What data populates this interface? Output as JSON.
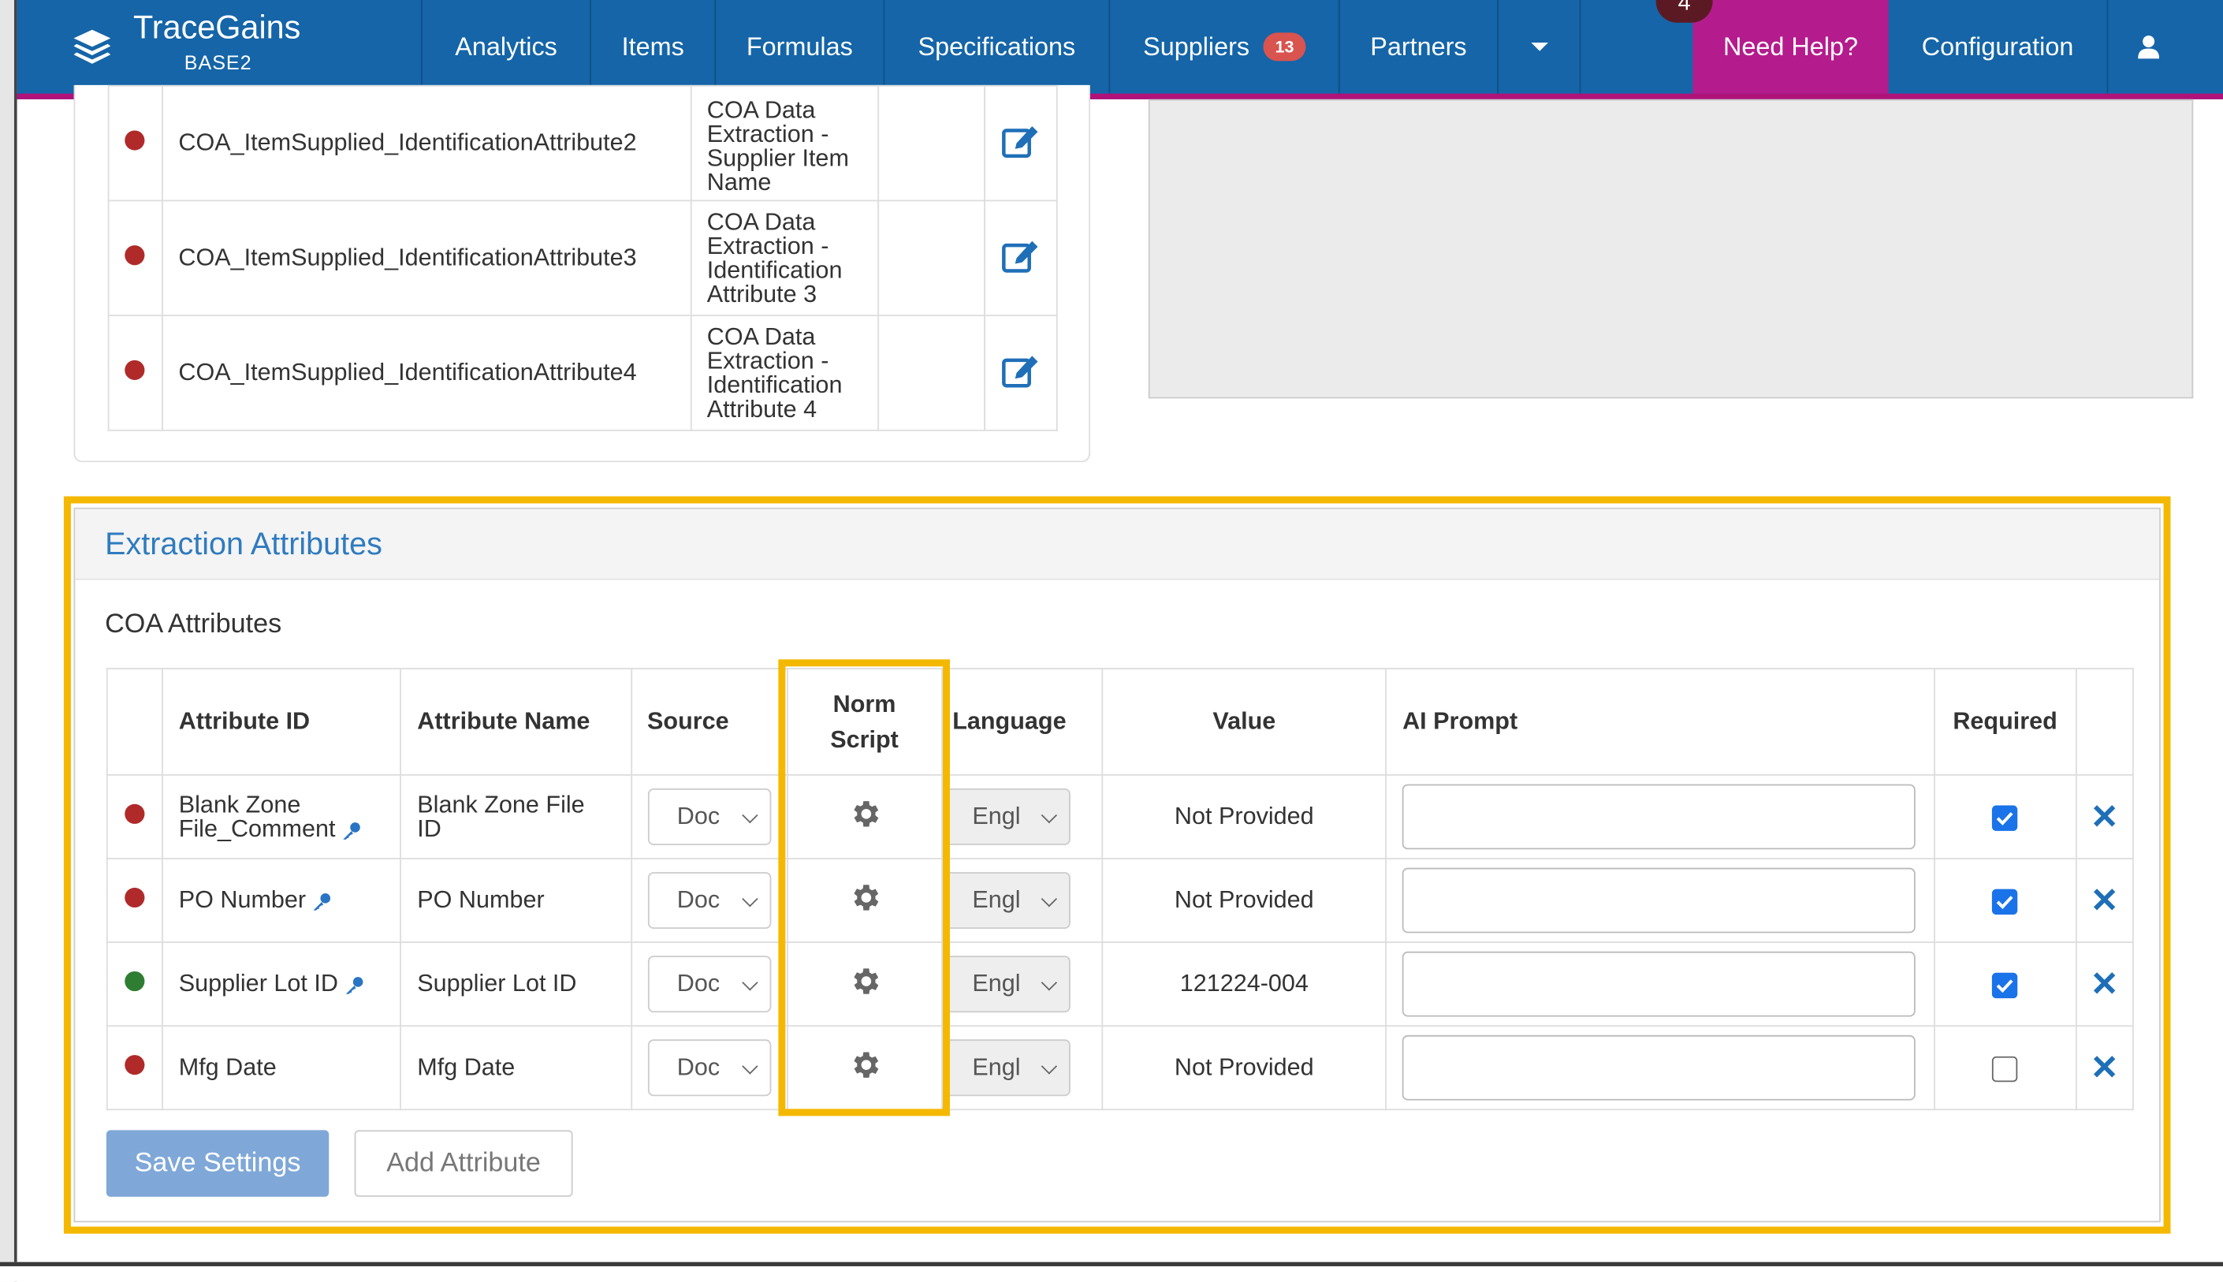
{
  "nav": {
    "brand": "TraceGains",
    "instance": "BASE2",
    "items": [
      "Analytics",
      "Items",
      "Formulas",
      "Specifications",
      "Suppliers",
      "Partners"
    ],
    "suppliers_badge": "13",
    "help_badge": "4",
    "help": "Need Help?",
    "configuration": "Configuration"
  },
  "upper_rows": [
    {
      "id": "COA_ItemSupplied_IdentificationAttribute2",
      "desc": "COA Data Extraction - Supplier Item Name",
      "status": "red"
    },
    {
      "id": "COA_ItemSupplied_IdentificationAttribute3",
      "desc": "COA Data Extraction - Identification Attribute 3",
      "status": "red"
    },
    {
      "id": "COA_ItemSupplied_IdentificationAttribute4",
      "desc": "COA Data Extraction - Identification Attribute 4",
      "status": "red"
    }
  ],
  "section": {
    "title": "Extraction Attributes",
    "subtitle": "COA Attributes",
    "headers": {
      "attribute_id": "Attribute ID",
      "attribute_name": "Attribute Name",
      "source": "Source",
      "norm_script": "Norm Script",
      "language": "Language",
      "value": "Value",
      "ai_prompt": "AI Prompt",
      "required": "Required"
    },
    "rows": [
      {
        "attr_id": "Blank Zone File_Comment",
        "name": "Blank Zone File ID",
        "source": "Doc",
        "language": "Engl",
        "value": "Not Provided",
        "required": true,
        "status": "red"
      },
      {
        "attr_id": "PO Number",
        "name": "PO Number",
        "source": "Doc",
        "language": "Engl",
        "value": "Not Provided",
        "required": true,
        "status": "red"
      },
      {
        "attr_id": "Supplier Lot ID",
        "name": "Supplier Lot ID",
        "source": "Doc",
        "language": "Engl",
        "value": "121224-004",
        "required": true,
        "status": "green"
      },
      {
        "attr_id": "Mfg Date",
        "name": "Mfg Date",
        "source": "Doc",
        "language": "Engl",
        "value": "Not Provided",
        "required": false,
        "status": "red"
      }
    ],
    "save_label": "Save Settings",
    "add_label": "Add Attribute"
  },
  "colors": {
    "nav_bg": "#1565a8",
    "help_bg": "#b41c8d",
    "highlight": "#f5b800",
    "link": "#2f7bbf"
  }
}
